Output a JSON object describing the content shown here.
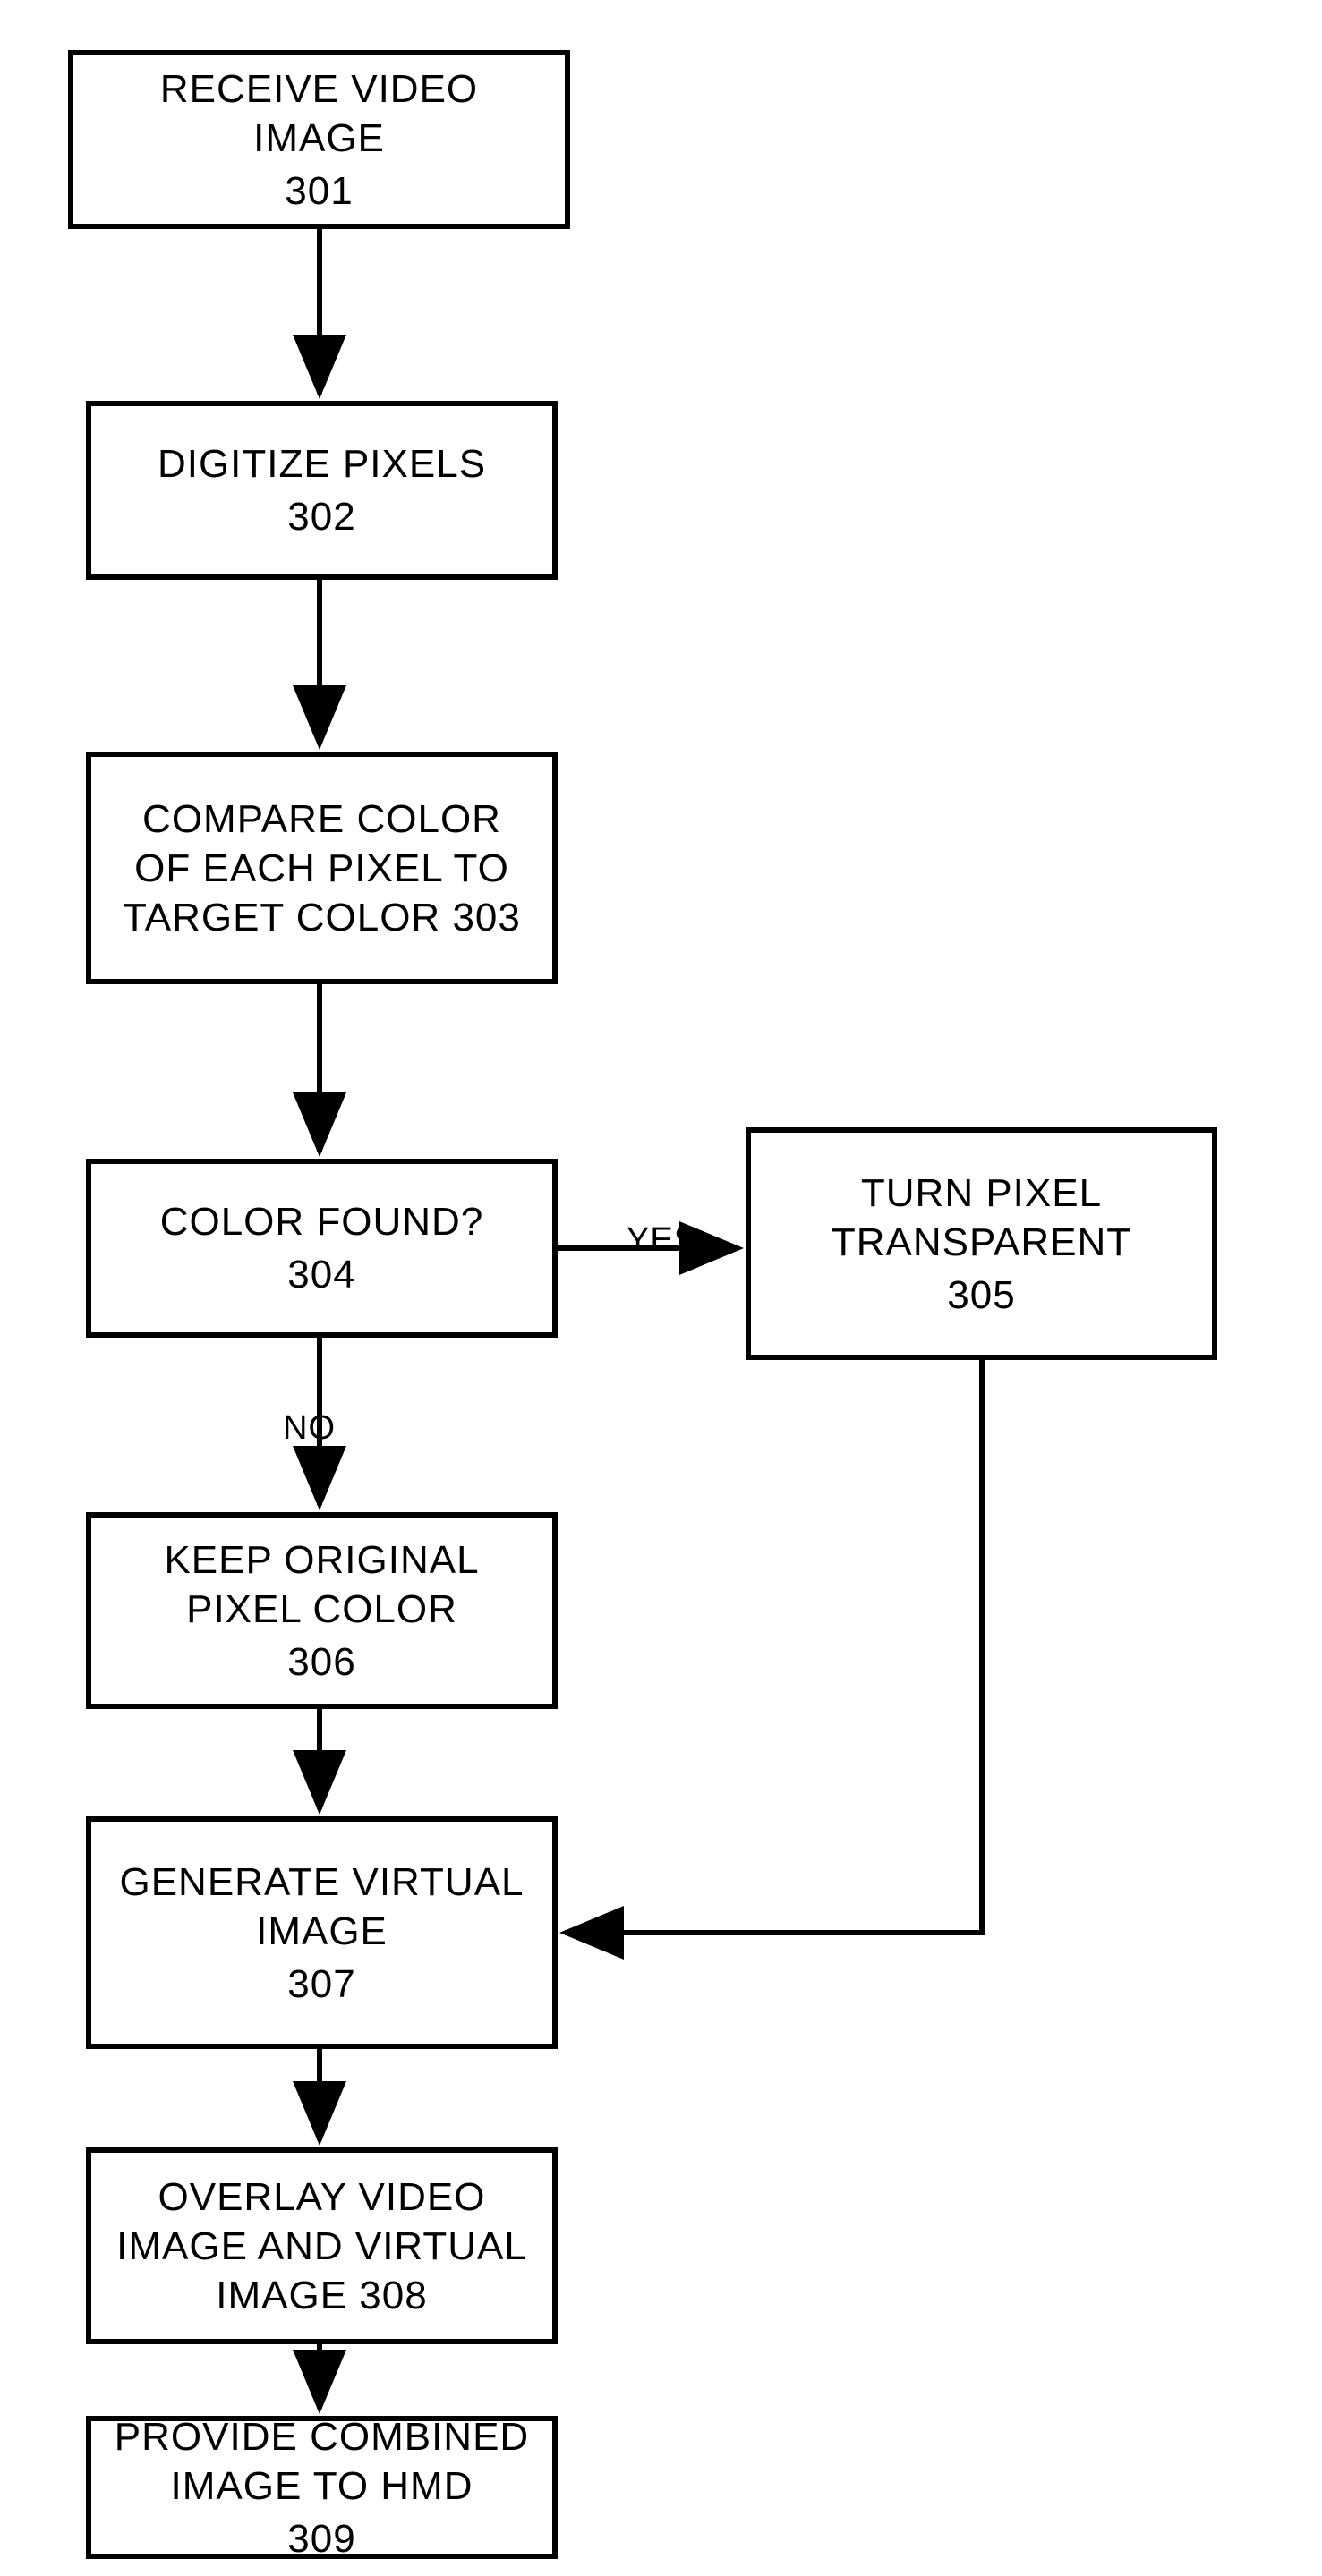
{
  "nodes": {
    "n301": {
      "label": "RECEIVE VIDEO IMAGE",
      "ref": "301"
    },
    "n302": {
      "label": "DIGITIZE PIXELS",
      "ref": "302"
    },
    "n303": {
      "label": "COMPARE COLOR OF EACH PIXEL TO TARGET COLOR",
      "ref": "303",
      "inlineRef": true
    },
    "n304": {
      "label": "COLOR FOUND?",
      "ref": "304"
    },
    "n305": {
      "label": "TURN PIXEL TRANSPARENT",
      "ref": "305"
    },
    "n306": {
      "label": "KEEP ORIGINAL PIXEL COLOR",
      "ref": "306"
    },
    "n307": {
      "label": "GENERATE VIRTUAL IMAGE",
      "ref": "307"
    },
    "n308": {
      "label": "OVERLAY VIDEO IMAGE AND VIRTUAL IMAGE",
      "ref": "308",
      "inlineRef": true
    },
    "n309": {
      "label": "PROVIDE COMBINED IMAGE TO HMD",
      "ref": "309"
    }
  },
  "edgeLabels": {
    "yes": "YES",
    "no": "NO"
  }
}
